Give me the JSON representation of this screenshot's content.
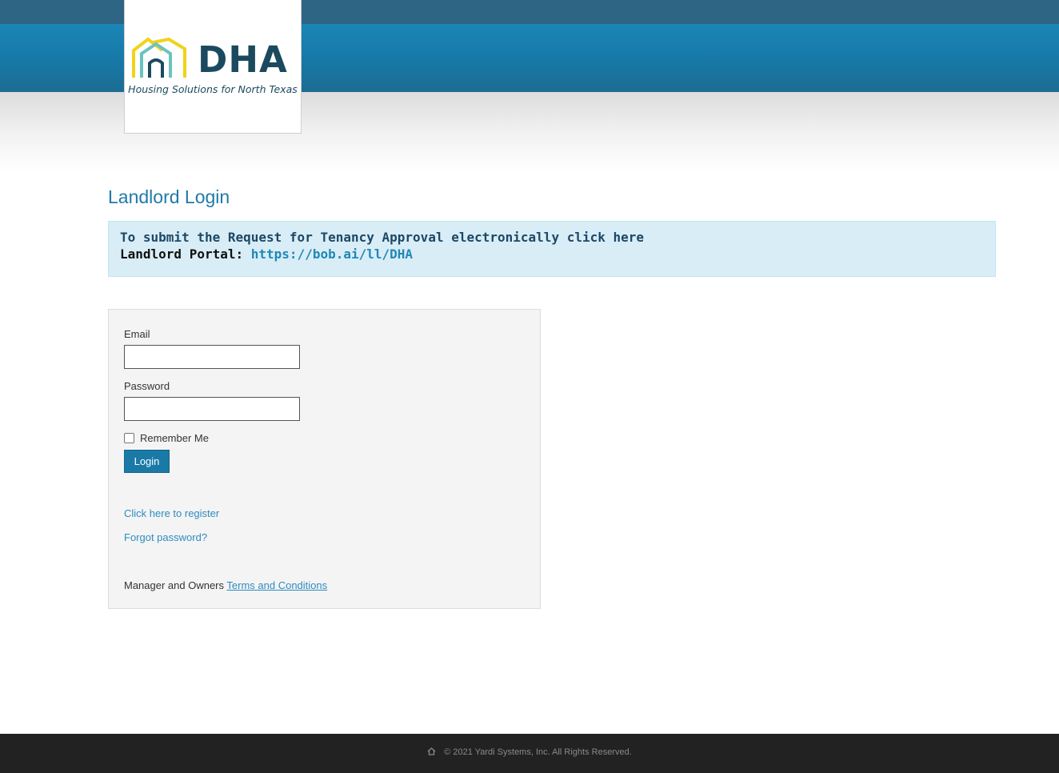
{
  "branding": {
    "logo_text": "DHA",
    "tagline": "Housing Solutions for North Texas"
  },
  "page": {
    "title": "Landlord Login"
  },
  "notice": {
    "line1": "To submit the Request for Tenancy Approval electronically click here",
    "portal_label": "Landlord Portal:",
    "portal_url": "https://bob.ai/ll/DHA"
  },
  "login_form": {
    "email_label": "Email",
    "email_value": "",
    "password_label": "Password",
    "password_value": "",
    "remember_label": "Remember Me",
    "remember_checked": false,
    "login_button": "Login",
    "register_link": "Click here to register",
    "forgot_link": "Forgot password?",
    "terms_prefix": "Manager and Owners",
    "terms_link": "Terms and Conditions"
  },
  "footer": {
    "copyright": "© 2021 Yardi Systems, Inc. All Rights Reserved.",
    "icon": "home-icon"
  },
  "colors": {
    "header_dark": "#2e6584",
    "header_blue": "#1a86b7",
    "title_blue": "#1f7aa8",
    "notice_bg": "#d9edf7",
    "button_bg": "#1a7aa7",
    "link": "#2e8cc0",
    "footer_bg": "#222222",
    "logo_yellow": "#f2d21a",
    "logo_teal": "#6bc3c1",
    "logo_navy": "#1b4a5f"
  }
}
